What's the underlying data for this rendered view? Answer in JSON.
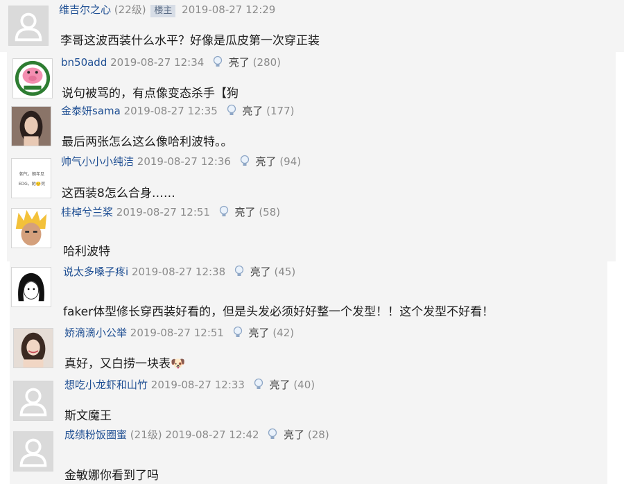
{
  "comments": [
    {
      "user": "维吉尔之心",
      "level": "(22级)",
      "badge": "楼主",
      "time": "2019-08-27 12:29",
      "like_label": "",
      "like_count": "",
      "text": "李哥这波西装什么水平？好像是瓜皮第一次穿正装",
      "avatar": "default-avatar"
    },
    {
      "user": "bn50add",
      "level": "",
      "badge": "",
      "time": "2019-08-27 12:34",
      "like_label": "亮了",
      "like_count": "(280)",
      "text": "说句被骂的，有点像变态杀手【狗",
      "avatar": "pig-avatar"
    },
    {
      "user": "金泰妍sama",
      "level": "",
      "badge": "",
      "time": "2019-08-27 12:35",
      "like_label": "亮了",
      "like_count": "(177)",
      "text": "最后两张怎么这么像哈利波特。。",
      "avatar": "portrait-avatar"
    },
    {
      "user": "帅气小小小纯洁",
      "level": "",
      "badge": "",
      "time": "2019-08-27 12:36",
      "like_label": "亮了",
      "like_count": "(94)",
      "text": "这西装8怎么合身……",
      "avatar": "text-avatar",
      "avatar_text": [
        "朝气，朝年见",
        "EDG，她🙂死"
      ]
    },
    {
      "user": "桂棹兮兰桨",
      "level": "",
      "badge": "",
      "time": "2019-08-27 12:51",
      "like_label": "亮了",
      "like_count": "(58)",
      "text": "哈利波特",
      "avatar": "spiky-hair-avatar"
    },
    {
      "user": "说太多嗓子疼i",
      "level": "",
      "badge": "",
      "time": "2019-08-27 12:38",
      "like_label": "亮了",
      "like_count": "(45)",
      "text": "faker体型修长穿西装好看的，但是头发必须好好整一个发型！！这个发型不好看！",
      "avatar": "sketch-avatar"
    },
    {
      "user": "娇滴滴小公举",
      "level": "",
      "badge": "",
      "time": "2019-08-27 12:51",
      "like_label": "亮了",
      "like_count": "(42)",
      "text": "真好，又白捞一块表🐶",
      "avatar": "girl-avatar"
    },
    {
      "user": "想吃小龙虾和山竹",
      "level": "",
      "badge": "",
      "time": "2019-08-27 12:33",
      "like_label": "亮了",
      "like_count": "(40)",
      "text": "斯文魔王",
      "avatar": "default-avatar"
    },
    {
      "user": "成绩粉饭圈蜜",
      "level": "(21级)",
      "badge": "",
      "time": "2019-08-27 12:42",
      "like_label": "亮了",
      "like_count": "(28)",
      "text": "金敏娜你看到了吗",
      "avatar": "default-avatar"
    }
  ]
}
